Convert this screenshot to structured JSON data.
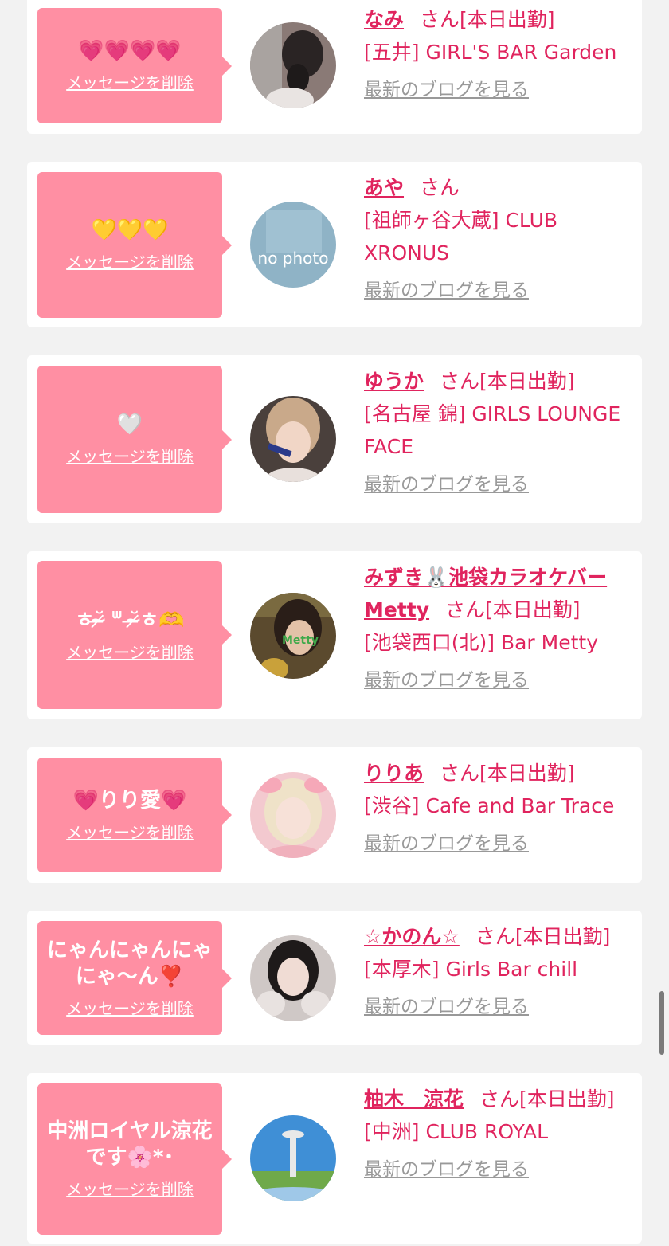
{
  "delete_label": "メッセージを削除",
  "blog_label": "最新のブログを見る",
  "san_label": "さん",
  "entries": [
    {
      "message": "💗💗💗💗",
      "name": "なみ",
      "status": "[本日出勤]",
      "shop": "[五井] GIRL'S BAR Garden",
      "avatar": "photo-woman-hair-back"
    },
    {
      "message": "💛💛💛",
      "name": "あや",
      "status": "",
      "shop": "[祖師ヶ谷大蔵] CLUB XRONUS",
      "avatar": "no-photo-placeholder",
      "avatar_text": "no photo"
    },
    {
      "message": "🤍",
      "name": "ゆうか",
      "status": "[本日出勤]",
      "shop": "[名古屋 錦] GIRLS LOUNGE FACE",
      "avatar": "photo-woman-selfie"
    },
    {
      "message": "ㅎ˘̴̶̷ ᐜ ˘̴̶̷ㅎ🫶",
      "name": "みずき🐰池袋カラオケバーMetty",
      "status": "[本日出勤]",
      "shop": "[池袋西口(北)] Bar Metty",
      "avatar": "photo-woman-metty"
    },
    {
      "message": "💗りり愛💗",
      "name": "りりあ",
      "status": "[本日出勤]",
      "shop": "[渋谷] Cafe and Bar Trace",
      "avatar": "photo-woman-blonde"
    },
    {
      "message": "にゃんにゃんにゃにゃ〜ん❣️",
      "name": "☆かのん☆",
      "status": "[本日出勤]",
      "shop": "[本厚木] Girls Bar chill",
      "avatar": "photo-woman-dark-hair"
    },
    {
      "message": "中洲ロイヤル涼花です🌸*･",
      "name": "柚木　涼花",
      "status": "[本日出勤]",
      "shop": "[中洲] CLUB ROYAL",
      "avatar": "photo-tower-sky"
    }
  ],
  "colors": {
    "background": "#f2f2f2",
    "card": "#ffffff",
    "bubble": "#ff8fa3",
    "name_text": "#e0245e",
    "blog_link": "#999999"
  }
}
